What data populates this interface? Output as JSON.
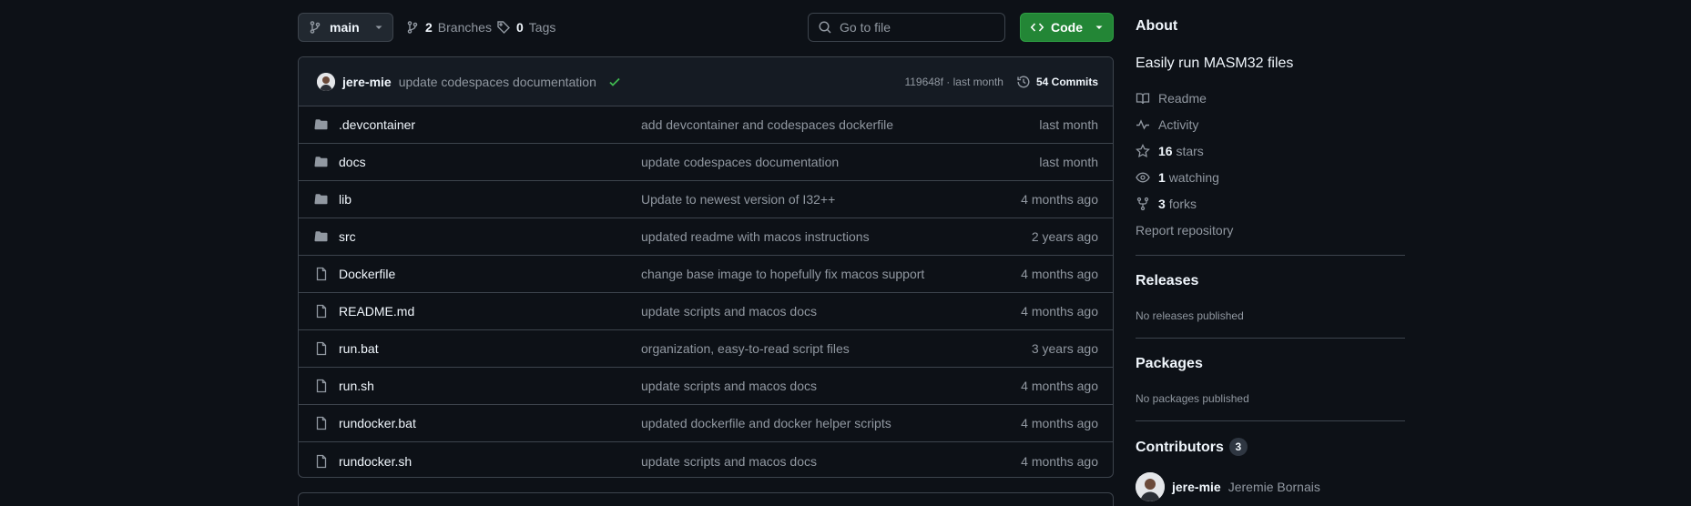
{
  "toolbar": {
    "branch": "main",
    "branches_count": "2",
    "branches_label": "Branches",
    "tags_count": "0",
    "tags_label": "Tags",
    "search_placeholder": "Go to file",
    "code_label": "Code"
  },
  "latest_commit": {
    "author": "jere-mie",
    "message": "update codespaces documentation",
    "status": "success",
    "sha_time": "119648f · last month",
    "commits_label": "54 Commits"
  },
  "files": [
    {
      "type": "folder",
      "name": ".devcontainer",
      "message": "add devcontainer and codespaces dockerfile",
      "date": "last month"
    },
    {
      "type": "folder",
      "name": "docs",
      "message": "update codespaces documentation",
      "date": "last month"
    },
    {
      "type": "folder",
      "name": "lib",
      "message": "Update to newest version of I32++",
      "date": "4 months ago"
    },
    {
      "type": "folder",
      "name": "src",
      "message": "updated readme with macos instructions",
      "date": "2 years ago"
    },
    {
      "type": "file",
      "name": "Dockerfile",
      "message": "change base image to hopefully fix macos support",
      "date": "4 months ago"
    },
    {
      "type": "file",
      "name": "README.md",
      "message": "update scripts and macos docs",
      "date": "4 months ago"
    },
    {
      "type": "file",
      "name": "run.bat",
      "message": "organization, easy-to-read script files",
      "date": "3 years ago"
    },
    {
      "type": "file",
      "name": "run.sh",
      "message": "update scripts and macos docs",
      "date": "4 months ago"
    },
    {
      "type": "file",
      "name": "rundocker.bat",
      "message": "updated dockerfile and docker helper scripts",
      "date": "4 months ago"
    },
    {
      "type": "file",
      "name": "rundocker.sh",
      "message": "update scripts and macos docs",
      "date": "4 months ago"
    }
  ],
  "about": {
    "title": "About",
    "description": "Easily run MASM32 files",
    "readme": "Readme",
    "activity": "Activity",
    "stars_count": "16",
    "stars_label": "stars",
    "watching_count": "1",
    "watching_label": "watching",
    "forks_count": "3",
    "forks_label": "forks",
    "report": "Report repository"
  },
  "releases": {
    "title": "Releases",
    "note": "No releases published"
  },
  "packages": {
    "title": "Packages",
    "note": "No packages published"
  },
  "contributors": {
    "title": "Contributors",
    "count": "3",
    "items": [
      {
        "login": "jere-mie",
        "name": "Jeremie Bornais"
      }
    ]
  },
  "colors": {
    "background": "#0d1117",
    "accent_green": "#238636",
    "success_check": "#3fb950",
    "border": "#3d444d"
  }
}
